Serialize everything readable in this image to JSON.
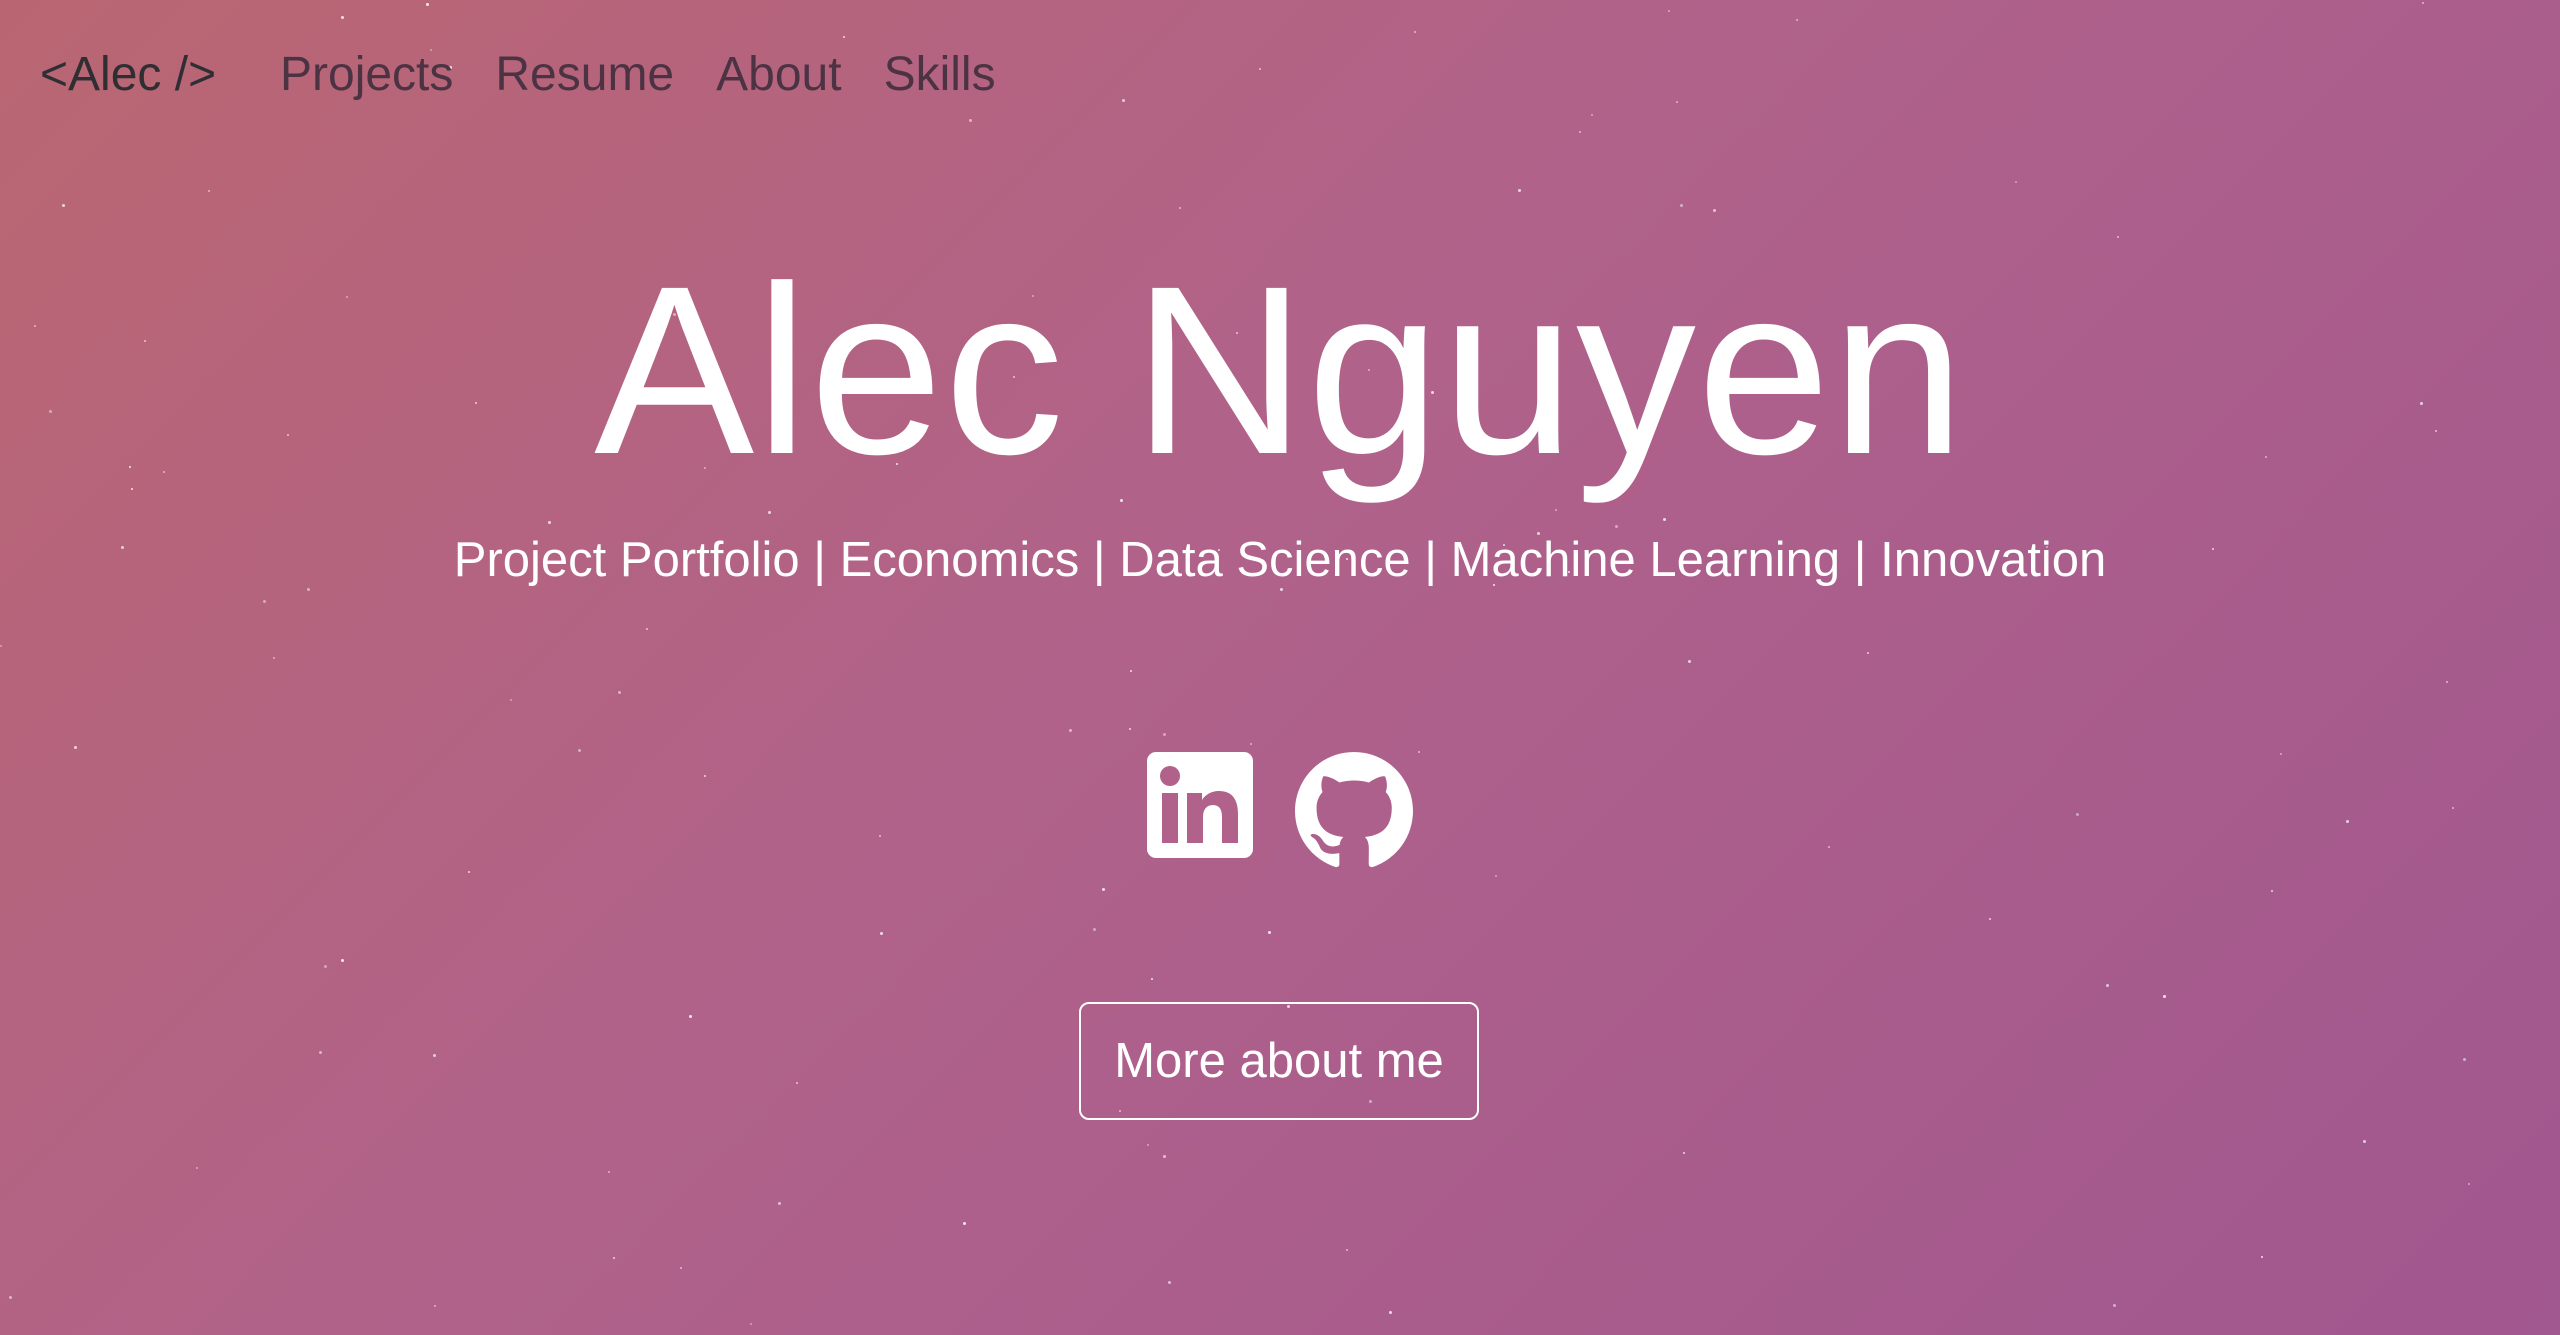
{
  "navbar": {
    "brand": "<Alec />",
    "links": [
      {
        "label": "Projects"
      },
      {
        "label": "Resume"
      },
      {
        "label": "About"
      },
      {
        "label": "Skills"
      }
    ]
  },
  "hero": {
    "name": "Alec Nguyen",
    "subtitle": "Project Portfolio | Economics | Data Science | Machine Learning | Innovation",
    "cta_label": "More about me"
  },
  "social": [
    {
      "name": "linkedin",
      "icon": "linkedin-icon"
    },
    {
      "name": "github",
      "icon": "github-icon"
    }
  ],
  "colors": {
    "gradient_start": "#ba6672",
    "gradient_end": "#a1578f",
    "brand_text": "#2e2e33",
    "nav_text": "#4c3344",
    "hero_text": "#ffffff"
  }
}
